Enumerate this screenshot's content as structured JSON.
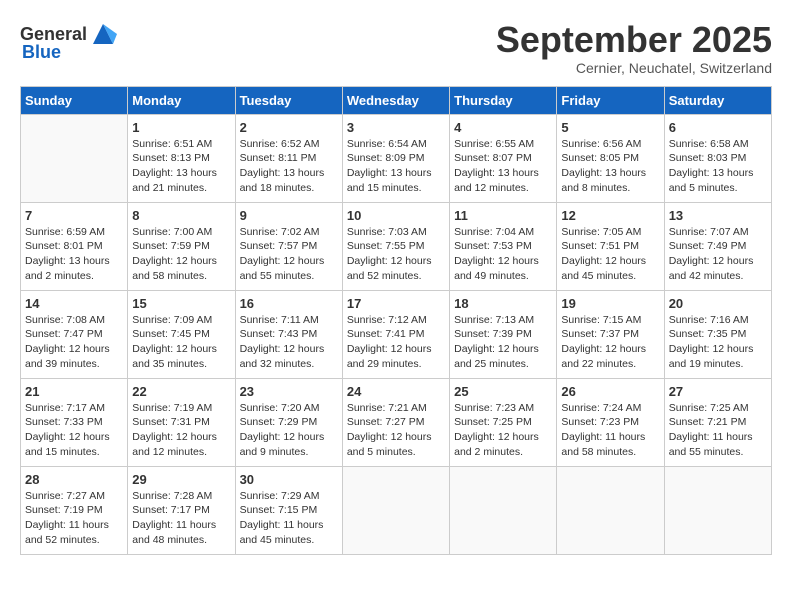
{
  "header": {
    "logo_general": "General",
    "logo_blue": "Blue",
    "month": "September 2025",
    "location": "Cernier, Neuchatel, Switzerland"
  },
  "weekdays": [
    "Sunday",
    "Monday",
    "Tuesday",
    "Wednesday",
    "Thursday",
    "Friday",
    "Saturday"
  ],
  "weeks": [
    [
      {
        "day": "",
        "sunrise": "",
        "sunset": "",
        "daylight": ""
      },
      {
        "day": "1",
        "sunrise": "Sunrise: 6:51 AM",
        "sunset": "Sunset: 8:13 PM",
        "daylight": "Daylight: 13 hours and 21 minutes."
      },
      {
        "day": "2",
        "sunrise": "Sunrise: 6:52 AM",
        "sunset": "Sunset: 8:11 PM",
        "daylight": "Daylight: 13 hours and 18 minutes."
      },
      {
        "day": "3",
        "sunrise": "Sunrise: 6:54 AM",
        "sunset": "Sunset: 8:09 PM",
        "daylight": "Daylight: 13 hours and 15 minutes."
      },
      {
        "day": "4",
        "sunrise": "Sunrise: 6:55 AM",
        "sunset": "Sunset: 8:07 PM",
        "daylight": "Daylight: 13 hours and 12 minutes."
      },
      {
        "day": "5",
        "sunrise": "Sunrise: 6:56 AM",
        "sunset": "Sunset: 8:05 PM",
        "daylight": "Daylight: 13 hours and 8 minutes."
      },
      {
        "day": "6",
        "sunrise": "Sunrise: 6:58 AM",
        "sunset": "Sunset: 8:03 PM",
        "daylight": "Daylight: 13 hours and 5 minutes."
      }
    ],
    [
      {
        "day": "7",
        "sunrise": "Sunrise: 6:59 AM",
        "sunset": "Sunset: 8:01 PM",
        "daylight": "Daylight: 13 hours and 2 minutes."
      },
      {
        "day": "8",
        "sunrise": "Sunrise: 7:00 AM",
        "sunset": "Sunset: 7:59 PM",
        "daylight": "Daylight: 12 hours and 58 minutes."
      },
      {
        "day": "9",
        "sunrise": "Sunrise: 7:02 AM",
        "sunset": "Sunset: 7:57 PM",
        "daylight": "Daylight: 12 hours and 55 minutes."
      },
      {
        "day": "10",
        "sunrise": "Sunrise: 7:03 AM",
        "sunset": "Sunset: 7:55 PM",
        "daylight": "Daylight: 12 hours and 52 minutes."
      },
      {
        "day": "11",
        "sunrise": "Sunrise: 7:04 AM",
        "sunset": "Sunset: 7:53 PM",
        "daylight": "Daylight: 12 hours and 49 minutes."
      },
      {
        "day": "12",
        "sunrise": "Sunrise: 7:05 AM",
        "sunset": "Sunset: 7:51 PM",
        "daylight": "Daylight: 12 hours and 45 minutes."
      },
      {
        "day": "13",
        "sunrise": "Sunrise: 7:07 AM",
        "sunset": "Sunset: 7:49 PM",
        "daylight": "Daylight: 12 hours and 42 minutes."
      }
    ],
    [
      {
        "day": "14",
        "sunrise": "Sunrise: 7:08 AM",
        "sunset": "Sunset: 7:47 PM",
        "daylight": "Daylight: 12 hours and 39 minutes."
      },
      {
        "day": "15",
        "sunrise": "Sunrise: 7:09 AM",
        "sunset": "Sunset: 7:45 PM",
        "daylight": "Daylight: 12 hours and 35 minutes."
      },
      {
        "day": "16",
        "sunrise": "Sunrise: 7:11 AM",
        "sunset": "Sunset: 7:43 PM",
        "daylight": "Daylight: 12 hours and 32 minutes."
      },
      {
        "day": "17",
        "sunrise": "Sunrise: 7:12 AM",
        "sunset": "Sunset: 7:41 PM",
        "daylight": "Daylight: 12 hours and 29 minutes."
      },
      {
        "day": "18",
        "sunrise": "Sunrise: 7:13 AM",
        "sunset": "Sunset: 7:39 PM",
        "daylight": "Daylight: 12 hours and 25 minutes."
      },
      {
        "day": "19",
        "sunrise": "Sunrise: 7:15 AM",
        "sunset": "Sunset: 7:37 PM",
        "daylight": "Daylight: 12 hours and 22 minutes."
      },
      {
        "day": "20",
        "sunrise": "Sunrise: 7:16 AM",
        "sunset": "Sunset: 7:35 PM",
        "daylight": "Daylight: 12 hours and 19 minutes."
      }
    ],
    [
      {
        "day": "21",
        "sunrise": "Sunrise: 7:17 AM",
        "sunset": "Sunset: 7:33 PM",
        "daylight": "Daylight: 12 hours and 15 minutes."
      },
      {
        "day": "22",
        "sunrise": "Sunrise: 7:19 AM",
        "sunset": "Sunset: 7:31 PM",
        "daylight": "Daylight: 12 hours and 12 minutes."
      },
      {
        "day": "23",
        "sunrise": "Sunrise: 7:20 AM",
        "sunset": "Sunset: 7:29 PM",
        "daylight": "Daylight: 12 hours and 9 minutes."
      },
      {
        "day": "24",
        "sunrise": "Sunrise: 7:21 AM",
        "sunset": "Sunset: 7:27 PM",
        "daylight": "Daylight: 12 hours and 5 minutes."
      },
      {
        "day": "25",
        "sunrise": "Sunrise: 7:23 AM",
        "sunset": "Sunset: 7:25 PM",
        "daylight": "Daylight: 12 hours and 2 minutes."
      },
      {
        "day": "26",
        "sunrise": "Sunrise: 7:24 AM",
        "sunset": "Sunset: 7:23 PM",
        "daylight": "Daylight: 11 hours and 58 minutes."
      },
      {
        "day": "27",
        "sunrise": "Sunrise: 7:25 AM",
        "sunset": "Sunset: 7:21 PM",
        "daylight": "Daylight: 11 hours and 55 minutes."
      }
    ],
    [
      {
        "day": "28",
        "sunrise": "Sunrise: 7:27 AM",
        "sunset": "Sunset: 7:19 PM",
        "daylight": "Daylight: 11 hours and 52 minutes."
      },
      {
        "day": "29",
        "sunrise": "Sunrise: 7:28 AM",
        "sunset": "Sunset: 7:17 PM",
        "daylight": "Daylight: 11 hours and 48 minutes."
      },
      {
        "day": "30",
        "sunrise": "Sunrise: 7:29 AM",
        "sunset": "Sunset: 7:15 PM",
        "daylight": "Daylight: 11 hours and 45 minutes."
      },
      {
        "day": "",
        "sunrise": "",
        "sunset": "",
        "daylight": ""
      },
      {
        "day": "",
        "sunrise": "",
        "sunset": "",
        "daylight": ""
      },
      {
        "day": "",
        "sunrise": "",
        "sunset": "",
        "daylight": ""
      },
      {
        "day": "",
        "sunrise": "",
        "sunset": "",
        "daylight": ""
      }
    ]
  ]
}
